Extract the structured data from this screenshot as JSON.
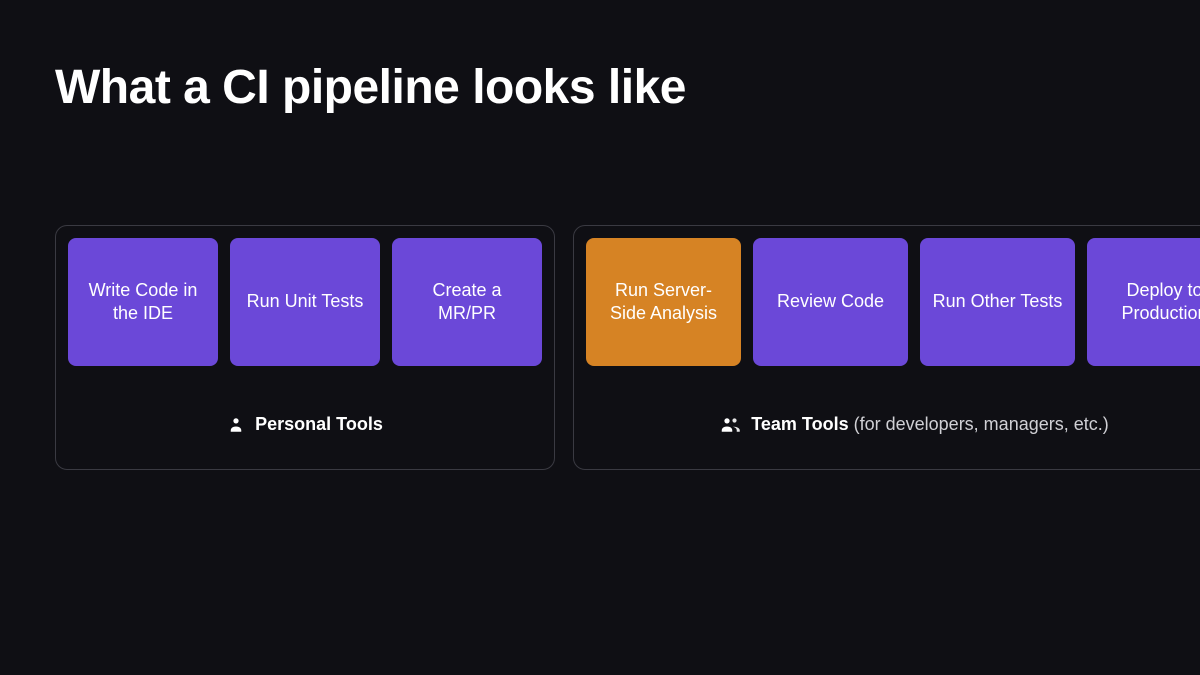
{
  "title": "What a CI pipeline looks like",
  "groups": {
    "personal": {
      "label": "Personal Tools",
      "steps": [
        "Write Code in the IDE",
        "Run Unit Tests",
        "Create a MR/PR"
      ]
    },
    "team": {
      "label": "Team Tools",
      "label_suffix": "(for developers, managers, etc.)",
      "steps": [
        "Run Server-Side Analysis",
        "Review Code",
        "Run Other Tests",
        "Deploy to Production"
      ]
    }
  },
  "colors": {
    "step": "#6b48d8",
    "step_highlight": "#d68324",
    "background": "#0f0f14"
  }
}
